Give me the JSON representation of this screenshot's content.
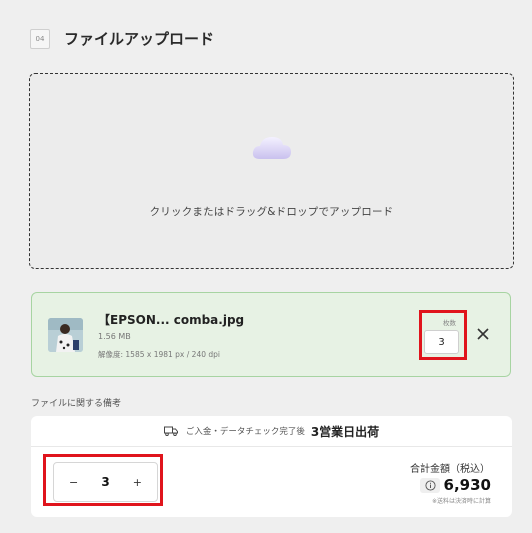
{
  "step": {
    "number": "04",
    "title": "ファイルアップロード"
  },
  "dropzone": {
    "text": "クリックまたはドラッグ&ドロップでアップロード",
    "icon": "cloud-upload-icon"
  },
  "file": {
    "name": "【EPSON... comba.jpg",
    "size": "1.56 MB",
    "resolution": "解像度: 1585 x 1981 px / 240 dpi",
    "quantity_label": "枚数",
    "quantity": "3"
  },
  "notes": {
    "label": "ファイルに関する備考"
  },
  "order": {
    "shipping_prefix": "ご入金・データチェック完了後",
    "shipping_main": "3営業日出荷",
    "stepper": {
      "minus": "−",
      "value": "3",
      "plus": "+"
    },
    "total_label": "合計金額（税込）",
    "total_amount": "6,930",
    "total_note": "※送料は決済時に計算"
  },
  "colors": {
    "highlight": "#e0141c",
    "success_bg": "#e7f2e4",
    "success_border": "#a7d4a2"
  }
}
